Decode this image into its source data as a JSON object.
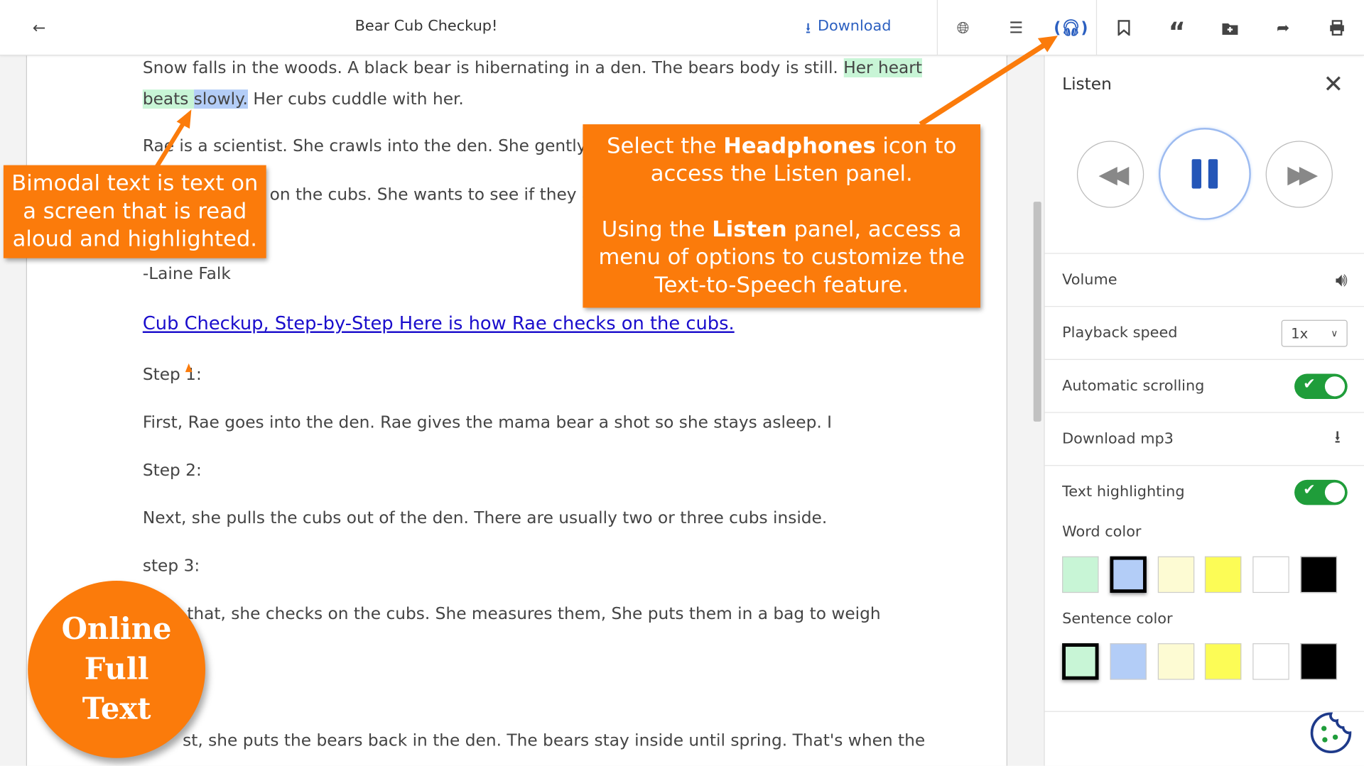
{
  "header": {
    "title": "Bear Cub Checkup!",
    "download_label": "Download",
    "icons": [
      "back-arrow-icon",
      "download-icon",
      "globe-icon",
      "list-icon",
      "headphones-icon",
      "bookmark-icon",
      "quote-icon",
      "folder-plus-icon",
      "share-icon",
      "print-icon"
    ],
    "accent": "#2b5fc0"
  },
  "document": {
    "p1a": "Snow falls in the woods. A black bear is hibernating in a den. The bears body is still. ",
    "p1_sentence_hl1": "Her heart",
    "p1_sentence_hl2": "beats ",
    "p1_word_hl": "slowly.",
    "p1b": " Her cubs cuddle with her.",
    "p2a": "Rae is a scientist. She crawls into the den. She gently ta",
    "p2b": "on the cubs. She wants to see if they ar",
    "author": "-Laine Falk",
    "link": "Cub Checkup, Step-by-Step Here is how Rae checks on the cubs.",
    "step1": "Step 1:",
    "step1_text": "First, Rae goes into the den. Rae gives the mama bear a shot so she stays asleep. I",
    "step2": "Step 2:",
    "step2_text": "Next, she pulls the cubs out of the den. There are usually two or three cubs inside.",
    "step3": "step 3:",
    "step3_text": "that, she checks on the cubs. She measures them, She puts them in a bag to weigh",
    "last_text": "st, she puts the bears back in the den. The bears stay inside until spring. That's when the"
  },
  "callouts": {
    "left": "Bimodal text is text on a screen that is read aloud and highlighted.",
    "right1_pre": "Select the ",
    "right1_bold": "Headphones",
    "right1_post": " icon to access the Listen panel.",
    "right2_pre": "Using the ",
    "right2_bold": "Listen",
    "right2_post": " panel, access a menu of options to customize the Text-to-Speech feature.",
    "badge": [
      "Online",
      "Full",
      "Text"
    ],
    "color": "#fb7b0b"
  },
  "listen_panel": {
    "title": "Listen",
    "volume": "Volume",
    "playback_speed": "Playback speed",
    "playback_speed_value": "1x",
    "automatic_scrolling": "Automatic scrolling",
    "automatic_scrolling_on": true,
    "download_mp3": "Download mp3",
    "text_highlighting": "Text highlighting",
    "text_highlighting_on": true,
    "word_color": "Word color",
    "sentence_color": "Sentence color",
    "swatches": [
      "#c8f5d6",
      "#b3cdf7",
      "#fdfbd3",
      "#fcfc56",
      "#ffffff",
      "#000000"
    ],
    "word_color_selected": "#b3cdf7",
    "sentence_color_selected": "#c8f5d6"
  }
}
